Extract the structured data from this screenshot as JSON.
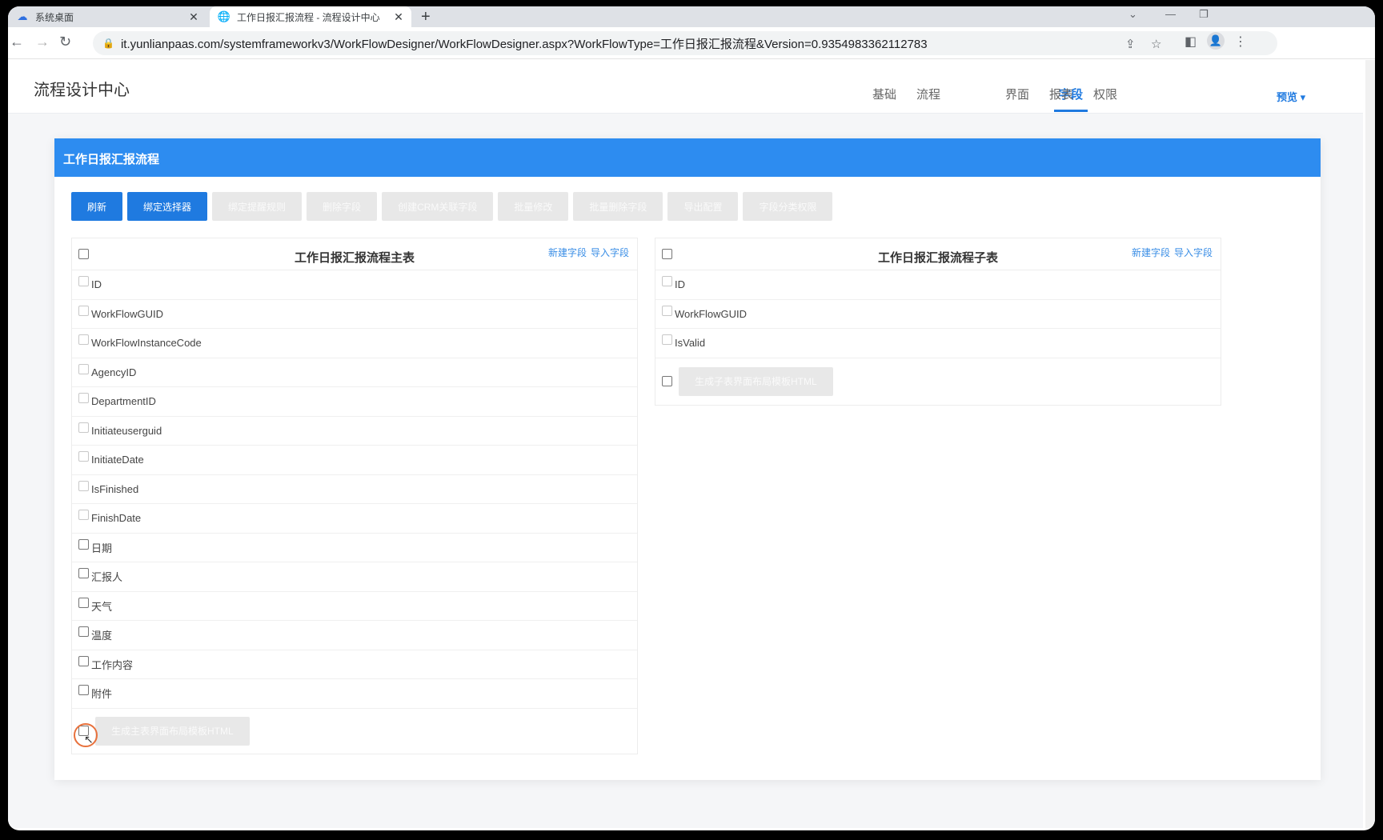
{
  "browser": {
    "tabs": [
      {
        "title": "系统桌面",
        "icon": "cloud-logo-icon"
      },
      {
        "title": "工作日报汇报流程 - 流程设计中心",
        "icon": "globe-icon"
      }
    ],
    "url": "it.yunlianpaas.com/systemframeworkv3/WorkFlowDesigner/WorkFlowDesigner.aspx?WorkFlowType=工作日报汇报流程&Version=0.9354983362112783"
  },
  "app": {
    "title": "流程设计中心",
    "nav": [
      "基础",
      "流程",
      "字段",
      "界面",
      "报表",
      "权限"
    ],
    "active_nav": "字段",
    "preview": "预览"
  },
  "card": {
    "title": "工作日报汇报流程",
    "buttons": [
      {
        "label": "刷新",
        "state": "primary"
      },
      {
        "label": "绑定选择器",
        "state": "primary"
      },
      {
        "label": "绑定提醒规则",
        "state": "disabled"
      },
      {
        "label": "删除字段",
        "state": "disabled"
      },
      {
        "label": "创建CRM关联字段",
        "state": "disabled"
      },
      {
        "label": "批量修改",
        "state": "disabled"
      },
      {
        "label": "批量删除字段",
        "state": "disabled"
      },
      {
        "label": "导出配置",
        "state": "disabled"
      },
      {
        "label": "字段分类权限",
        "state": "disabled"
      }
    ]
  },
  "main_table": {
    "title": "工作日报汇报流程主表",
    "new_field": "新建字段",
    "import_field": "导入字段",
    "fields": [
      {
        "name": "ID",
        "system": true
      },
      {
        "name": "WorkFlowGUID",
        "system": true
      },
      {
        "name": "WorkFlowInstanceCode",
        "system": true
      },
      {
        "name": "AgencyID",
        "system": true
      },
      {
        "name": "DepartmentID",
        "system": true
      },
      {
        "name": "Initiateuserguid",
        "system": true
      },
      {
        "name": "InitiateDate",
        "system": true
      },
      {
        "name": "IsFinished",
        "system": true
      },
      {
        "name": "FinishDate",
        "system": true
      },
      {
        "name": "日期",
        "system": false
      },
      {
        "name": "汇报人",
        "system": false
      },
      {
        "name": "天气",
        "system": false
      },
      {
        "name": "温度",
        "system": false
      },
      {
        "name": "工作内容",
        "system": false
      },
      {
        "name": "附件",
        "system": false
      }
    ],
    "generate_button": "生成主表界面布局模板HTML"
  },
  "sub_table": {
    "title": "工作日报汇报流程子表",
    "new_field": "新建字段",
    "import_field": "导入字段",
    "fields": [
      {
        "name": "ID",
        "system": true
      },
      {
        "name": "WorkFlowGUID",
        "system": true
      },
      {
        "name": "IsValid",
        "system": true
      }
    ],
    "generate_button": "生成子表界面布局模板HTML"
  }
}
